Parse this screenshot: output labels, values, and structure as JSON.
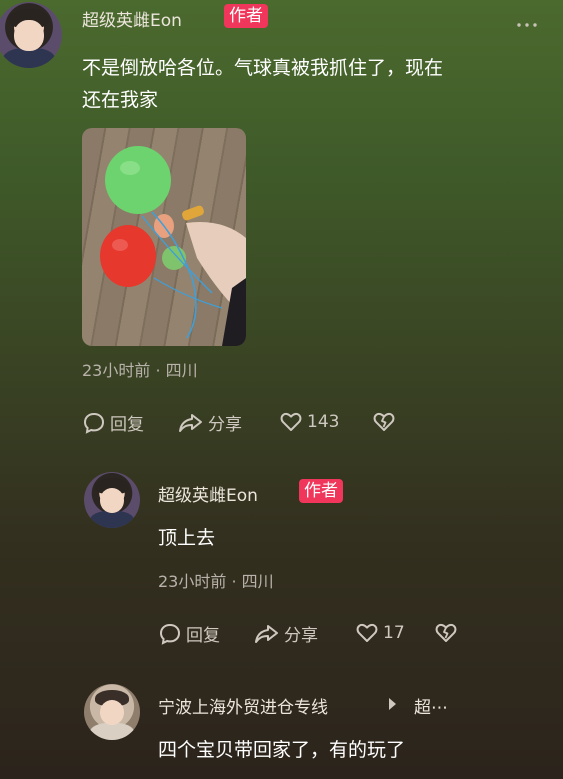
{
  "comments": [
    {
      "username": "超级英雌Eon",
      "badge": "作者",
      "text_line1": "不是倒放哈各位。气球真被我抓住了，现在",
      "text_line2": "还在我家",
      "meta": "23小时前 · 四川",
      "reply_label": "回复",
      "share_label": "分享",
      "like_count": "143",
      "more_icon": "ellipsis-icon"
    },
    {
      "username": "超级英雌Eon",
      "badge": "作者",
      "text": "顶上去",
      "meta": "23小时前 · 四川",
      "reply_label": "回复",
      "share_label": "分享",
      "like_count": "17"
    },
    {
      "username": "宁波上海外贸进仓专线",
      "reply_target": "超⋯",
      "text": "四个宝贝带回家了，有的玩了"
    }
  ],
  "colors": {
    "badge": "#f0365a",
    "balloon_green": "#6cd36f",
    "balloon_red": "#e6382c"
  }
}
